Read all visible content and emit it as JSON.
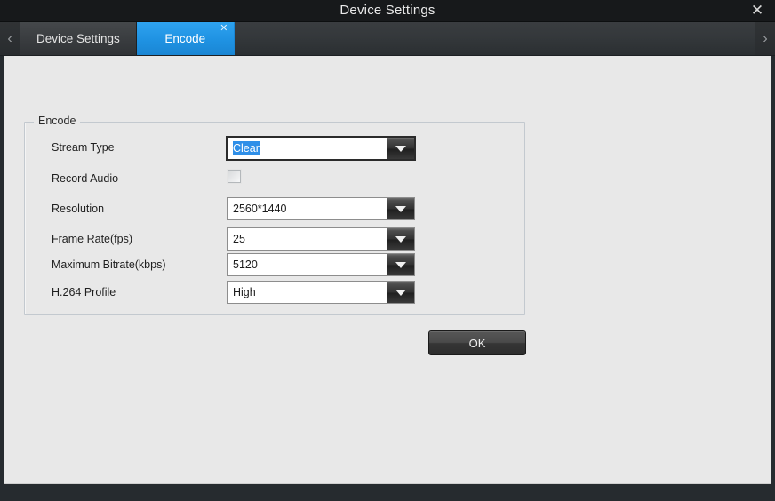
{
  "window": {
    "title": "Device Settings",
    "close_icon": "close-icon",
    "close_glyph": "✕"
  },
  "tabbar": {
    "prev_glyph": "‹",
    "next_glyph": "›",
    "tabs": [
      {
        "label": "Device Settings",
        "active": false,
        "closable": false
      },
      {
        "label": "Encode",
        "active": true,
        "closable": true,
        "close_glyph": "✕"
      }
    ]
  },
  "form": {
    "group_legend": "Encode",
    "rows": [
      {
        "label": "Stream Type",
        "control": "combo",
        "value": "Clear",
        "selected": true,
        "focused": true
      },
      {
        "label": "Record Audio",
        "control": "checkbox",
        "checked": false
      },
      {
        "label": "Resolution",
        "control": "combo",
        "value": "2560*1440",
        "selected": false,
        "focused": false
      },
      {
        "label": "Frame Rate(fps)",
        "control": "combo",
        "value": "25",
        "selected": false,
        "focused": false
      },
      {
        "label": "Maximum Bitrate(kbps)",
        "control": "combo",
        "value": "5120",
        "selected": false,
        "focused": false
      },
      {
        "label": "H.264 Profile",
        "control": "combo",
        "value": "High",
        "selected": false,
        "focused": false
      }
    ]
  },
  "actions": {
    "ok_label": "OK"
  },
  "colors": {
    "accent": "#1f92e2",
    "selection": "#2f8fe8",
    "titlebar": "#17191b",
    "panel": "#e8e8e8",
    "chrome": "#262b2f"
  }
}
